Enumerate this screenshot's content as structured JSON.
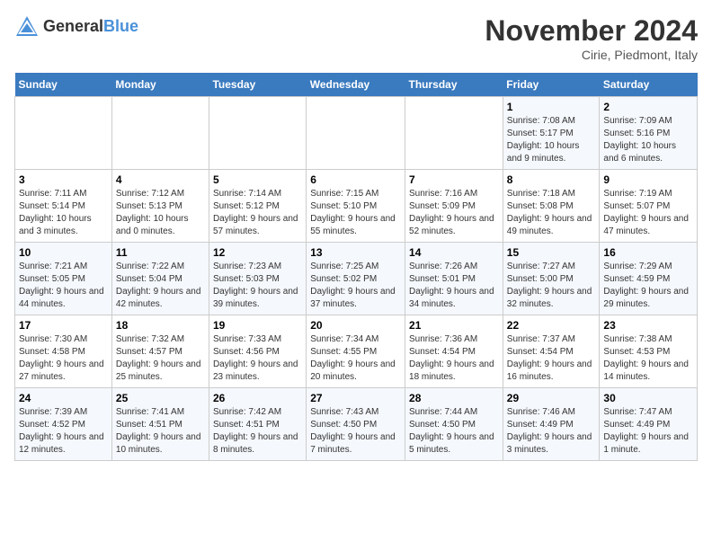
{
  "logo": {
    "text_general": "General",
    "text_blue": "Blue"
  },
  "title": "November 2024",
  "location": "Cirie, Piedmont, Italy",
  "weekdays": [
    "Sunday",
    "Monday",
    "Tuesday",
    "Wednesday",
    "Thursday",
    "Friday",
    "Saturday"
  ],
  "weeks": [
    [
      {
        "day": "",
        "info": ""
      },
      {
        "day": "",
        "info": ""
      },
      {
        "day": "",
        "info": ""
      },
      {
        "day": "",
        "info": ""
      },
      {
        "day": "",
        "info": ""
      },
      {
        "day": "1",
        "info": "Sunrise: 7:08 AM\nSunset: 5:17 PM\nDaylight: 10 hours and 9 minutes."
      },
      {
        "day": "2",
        "info": "Sunrise: 7:09 AM\nSunset: 5:16 PM\nDaylight: 10 hours and 6 minutes."
      }
    ],
    [
      {
        "day": "3",
        "info": "Sunrise: 7:11 AM\nSunset: 5:14 PM\nDaylight: 10 hours and 3 minutes."
      },
      {
        "day": "4",
        "info": "Sunrise: 7:12 AM\nSunset: 5:13 PM\nDaylight: 10 hours and 0 minutes."
      },
      {
        "day": "5",
        "info": "Sunrise: 7:14 AM\nSunset: 5:12 PM\nDaylight: 9 hours and 57 minutes."
      },
      {
        "day": "6",
        "info": "Sunrise: 7:15 AM\nSunset: 5:10 PM\nDaylight: 9 hours and 55 minutes."
      },
      {
        "day": "7",
        "info": "Sunrise: 7:16 AM\nSunset: 5:09 PM\nDaylight: 9 hours and 52 minutes."
      },
      {
        "day": "8",
        "info": "Sunrise: 7:18 AM\nSunset: 5:08 PM\nDaylight: 9 hours and 49 minutes."
      },
      {
        "day": "9",
        "info": "Sunrise: 7:19 AM\nSunset: 5:07 PM\nDaylight: 9 hours and 47 minutes."
      }
    ],
    [
      {
        "day": "10",
        "info": "Sunrise: 7:21 AM\nSunset: 5:05 PM\nDaylight: 9 hours and 44 minutes."
      },
      {
        "day": "11",
        "info": "Sunrise: 7:22 AM\nSunset: 5:04 PM\nDaylight: 9 hours and 42 minutes."
      },
      {
        "day": "12",
        "info": "Sunrise: 7:23 AM\nSunset: 5:03 PM\nDaylight: 9 hours and 39 minutes."
      },
      {
        "day": "13",
        "info": "Sunrise: 7:25 AM\nSunset: 5:02 PM\nDaylight: 9 hours and 37 minutes."
      },
      {
        "day": "14",
        "info": "Sunrise: 7:26 AM\nSunset: 5:01 PM\nDaylight: 9 hours and 34 minutes."
      },
      {
        "day": "15",
        "info": "Sunrise: 7:27 AM\nSunset: 5:00 PM\nDaylight: 9 hours and 32 minutes."
      },
      {
        "day": "16",
        "info": "Sunrise: 7:29 AM\nSunset: 4:59 PM\nDaylight: 9 hours and 29 minutes."
      }
    ],
    [
      {
        "day": "17",
        "info": "Sunrise: 7:30 AM\nSunset: 4:58 PM\nDaylight: 9 hours and 27 minutes."
      },
      {
        "day": "18",
        "info": "Sunrise: 7:32 AM\nSunset: 4:57 PM\nDaylight: 9 hours and 25 minutes."
      },
      {
        "day": "19",
        "info": "Sunrise: 7:33 AM\nSunset: 4:56 PM\nDaylight: 9 hours and 23 minutes."
      },
      {
        "day": "20",
        "info": "Sunrise: 7:34 AM\nSunset: 4:55 PM\nDaylight: 9 hours and 20 minutes."
      },
      {
        "day": "21",
        "info": "Sunrise: 7:36 AM\nSunset: 4:54 PM\nDaylight: 9 hours and 18 minutes."
      },
      {
        "day": "22",
        "info": "Sunrise: 7:37 AM\nSunset: 4:54 PM\nDaylight: 9 hours and 16 minutes."
      },
      {
        "day": "23",
        "info": "Sunrise: 7:38 AM\nSunset: 4:53 PM\nDaylight: 9 hours and 14 minutes."
      }
    ],
    [
      {
        "day": "24",
        "info": "Sunrise: 7:39 AM\nSunset: 4:52 PM\nDaylight: 9 hours and 12 minutes."
      },
      {
        "day": "25",
        "info": "Sunrise: 7:41 AM\nSunset: 4:51 PM\nDaylight: 9 hours and 10 minutes."
      },
      {
        "day": "26",
        "info": "Sunrise: 7:42 AM\nSunset: 4:51 PM\nDaylight: 9 hours and 8 minutes."
      },
      {
        "day": "27",
        "info": "Sunrise: 7:43 AM\nSunset: 4:50 PM\nDaylight: 9 hours and 7 minutes."
      },
      {
        "day": "28",
        "info": "Sunrise: 7:44 AM\nSunset: 4:50 PM\nDaylight: 9 hours and 5 minutes."
      },
      {
        "day": "29",
        "info": "Sunrise: 7:46 AM\nSunset: 4:49 PM\nDaylight: 9 hours and 3 minutes."
      },
      {
        "day": "30",
        "info": "Sunrise: 7:47 AM\nSunset: 4:49 PM\nDaylight: 9 hours and 1 minute."
      }
    ]
  ]
}
